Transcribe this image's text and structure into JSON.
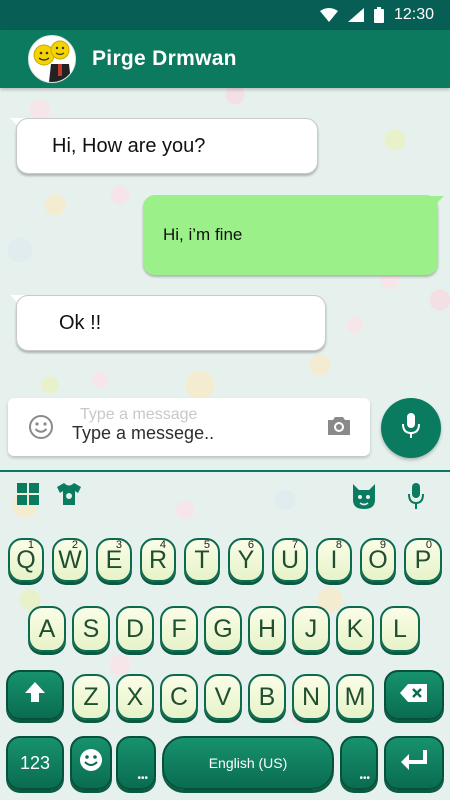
{
  "status_bar": {
    "time": "12:30",
    "icons": [
      "wifi-icon",
      "signal-icon",
      "battery-icon"
    ]
  },
  "header": {
    "contact_name": "Pirge Drmwan",
    "avatar": "avatar"
  },
  "messages": [
    {
      "direction": "in",
      "text": "Hi, How are you?"
    },
    {
      "direction": "out",
      "text": "Hi, i’m fine"
    },
    {
      "direction": "in",
      "text": "Ok !!"
    }
  ],
  "composer": {
    "ghost_text": "Type a message",
    "placeholder": "Type a messege..",
    "emoji_icon": "emoji-icon",
    "camera_icon": "camera-icon",
    "mic_icon": "mic-icon"
  },
  "toolbar": {
    "icons": [
      "grid-icon",
      "tshirt-icon",
      "cat-emoji-icon",
      "mic-icon"
    ]
  },
  "keyboard": {
    "row1": [
      {
        "label": "Q",
        "hint": "1"
      },
      {
        "label": "W",
        "hint": "2"
      },
      {
        "label": "E",
        "hint": "3"
      },
      {
        "label": "R",
        "hint": "4"
      },
      {
        "label": "T",
        "hint": "5"
      },
      {
        "label": "Y",
        "hint": "6"
      },
      {
        "label": "U",
        "hint": "7"
      },
      {
        "label": "I",
        "hint": "8"
      },
      {
        "label": "O",
        "hint": "9"
      },
      {
        "label": "P",
        "hint": "0"
      }
    ],
    "row2": [
      "A",
      "S",
      "D",
      "F",
      "G",
      "H",
      "J",
      "K",
      "L"
    ],
    "row3": [
      "Z",
      "X",
      "C",
      "V",
      "B",
      "N",
      "M"
    ],
    "numbers_key": "123",
    "space_label": "English (US)"
  },
  "colors": {
    "primary": "#0b7a5e",
    "status_bar": "#075e54",
    "outgoing_bubble": "#9cf08a",
    "key_face": "#f4f9dc"
  }
}
